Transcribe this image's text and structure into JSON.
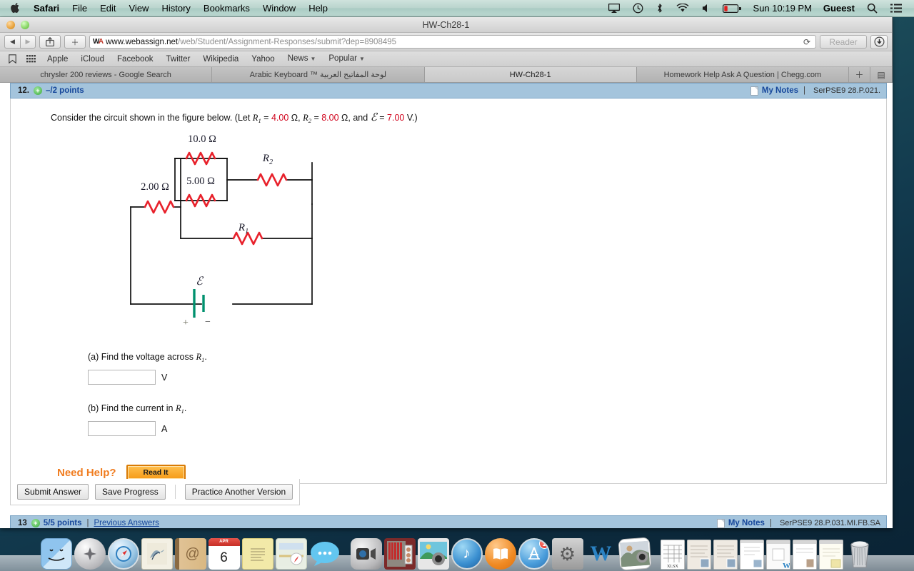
{
  "menubar": {
    "apple": "apple-logo",
    "items": [
      "Safari",
      "File",
      "Edit",
      "View",
      "History",
      "Bookmarks",
      "Window",
      "Help"
    ],
    "right_icons": [
      "airplay-icon",
      "timemachine-icon",
      "bluetooth-icon",
      "wifi-icon",
      "volume-icon",
      "battery-icon"
    ],
    "clock": "Sun 10:19 PM",
    "user": "Gueest",
    "search": "search-icon",
    "notifications": "notification-center-icon"
  },
  "window": {
    "title": "HW-Ch28-1",
    "url_host": "www.webassign.net",
    "url_path": "/web/Student/Assignment-Responses/submit?dep=8908495",
    "reader_label": "Reader",
    "favicon_text": "WA"
  },
  "bookmarks": [
    {
      "label": "Apple",
      "dropdown": false
    },
    {
      "label": "iCloud",
      "dropdown": false
    },
    {
      "label": "Facebook",
      "dropdown": false
    },
    {
      "label": "Twitter",
      "dropdown": false
    },
    {
      "label": "Wikipedia",
      "dropdown": false
    },
    {
      "label": "Yahoo",
      "dropdown": false
    },
    {
      "label": "News",
      "dropdown": true
    },
    {
      "label": "Popular",
      "dropdown": true
    }
  ],
  "tabs": [
    {
      "label": "chrysler 200 reviews - Google Search",
      "active": false
    },
    {
      "label": "Arabic Keyboard ™ لوحة المفاتيح العربية",
      "active": false
    },
    {
      "label": "HW-Ch28-1",
      "active": true
    },
    {
      "label": "Homework Help Ask A Question | Chegg.com",
      "active": false
    }
  ],
  "question": {
    "number": "12.",
    "points": "–/2 points",
    "my_notes": "My Notes",
    "code": "SerPSE9 28.P.021.",
    "prompt_prefix": "Consider the circuit shown in the figure below. (Let ",
    "r1_label": "R",
    "r1_sub": "1",
    "r1_value": "4.00",
    "r2_value": "8.00",
    "emf_value": "7.00",
    "ohm": "Ω",
    "volt": "V.)",
    "parts": [
      {
        "key": "(a) Find the voltage across ",
        "var": "R",
        "sub": "1",
        "tail": ".",
        "value": "",
        "unit": "V"
      },
      {
        "key": "(b) Find the current in ",
        "var": "R",
        "sub": "1",
        "tail": ".",
        "value": "",
        "unit": "A"
      }
    ],
    "need_help_label": "Need Help?",
    "read_it_label": "Read It",
    "buttons": [
      "Submit Answer",
      "Save Progress",
      "Practice Another Version"
    ]
  },
  "question13": {
    "number": "13",
    "points": "5/5 points",
    "previous_answers": "Previous Answers",
    "my_notes": "My Notes",
    "code": "SerPSE9 28.P.031.MI.FB.SA"
  },
  "figure": {
    "type": "circuit-diagram",
    "resistor_color": "#e8212b",
    "wire_color": "#111111",
    "battery_color": "#00916e",
    "labels": {
      "r_top": "10.0 Ω",
      "r_mid": "5.00 Ω",
      "r_left": "2.00 Ω",
      "r2": "R",
      "r2_sub": "2",
      "r1": "R",
      "r1_sub": "1",
      "emf": "ℰ",
      "plus": "+",
      "minus": "−"
    }
  },
  "dock": {
    "items": [
      {
        "name": "finder-icon",
        "glyph": ""
      },
      {
        "name": "launchpad-icon",
        "glyph": ""
      },
      {
        "name": "safari-icon",
        "glyph": ""
      },
      {
        "name": "mail-icon",
        "glyph": ""
      },
      {
        "name": "contacts-icon",
        "glyph": "@"
      },
      {
        "name": "calendar-icon",
        "glyph": "6",
        "top": "APR"
      },
      {
        "name": "notes-icon",
        "glyph": ""
      },
      {
        "name": "maps-icon",
        "glyph": ""
      },
      {
        "name": "messages-icon",
        "glyph": ""
      },
      {
        "name": "facetime-icon",
        "glyph": ""
      },
      {
        "name": "photobooth-icon",
        "glyph": ""
      },
      {
        "name": "iphoto-icon",
        "glyph": ""
      },
      {
        "name": "itunes-icon",
        "glyph": "♪"
      },
      {
        "name": "ibooks-icon",
        "glyph": ""
      },
      {
        "name": "appstore-icon",
        "glyph": "A",
        "badge": "1"
      },
      {
        "name": "system-preferences-icon",
        "glyph": "⚙"
      },
      {
        "name": "word-icon",
        "glyph": "W"
      },
      {
        "name": "imovie-icon",
        "glyph": ""
      }
    ],
    "minimized": [
      {
        "name": "excel-document-icon",
        "label": "XLSX"
      },
      {
        "name": "minimized-window-1",
        "label": ""
      },
      {
        "name": "minimized-window-2",
        "label": ""
      },
      {
        "name": "minimized-window-3",
        "label": ""
      },
      {
        "name": "minimized-window-4",
        "label": ""
      },
      {
        "name": "minimized-window-5",
        "label": ""
      },
      {
        "name": "minimized-window-6",
        "label": ""
      }
    ],
    "trash": "trash-icon"
  }
}
